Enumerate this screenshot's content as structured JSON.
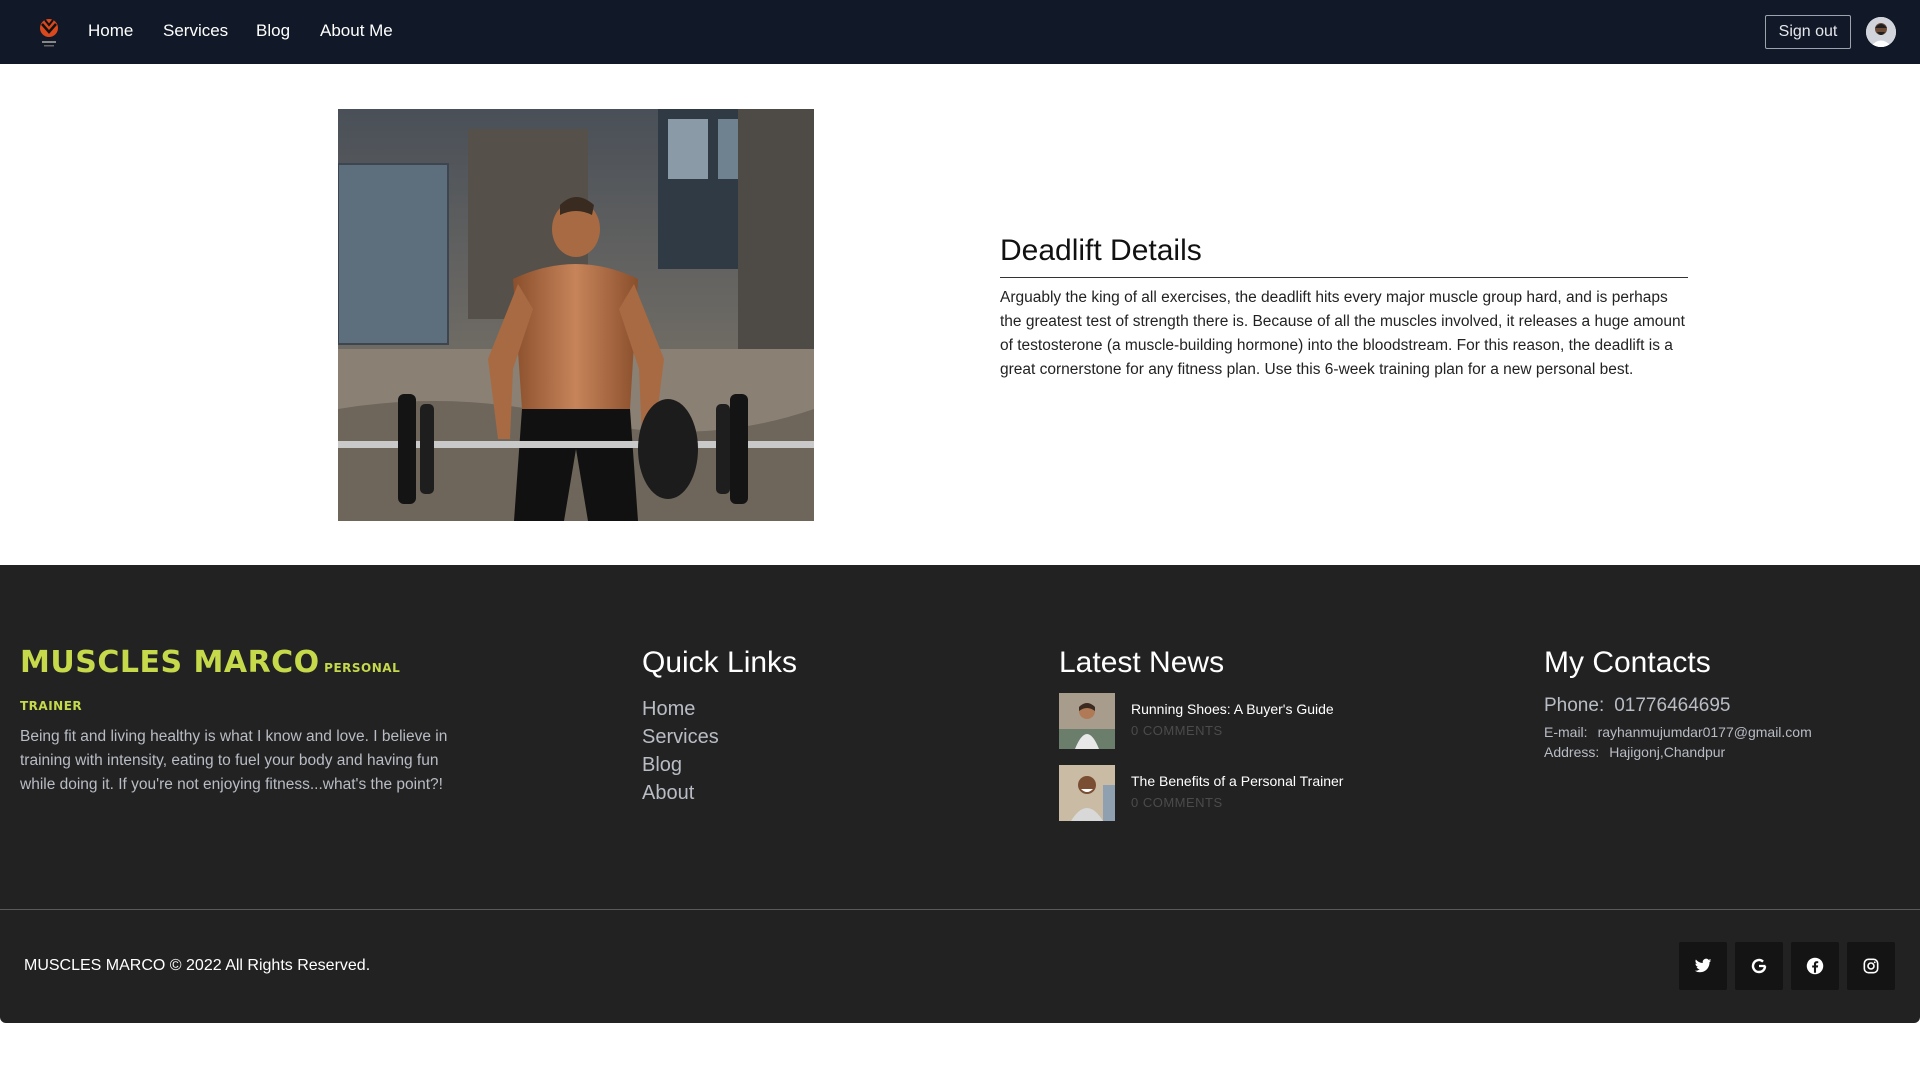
{
  "nav": {
    "links": [
      "Home",
      "Services",
      "Blog",
      "About Me"
    ],
    "sign_out": "Sign out",
    "logo_icon": "muscles-marco-logo",
    "avatar_icon": "user-avatar"
  },
  "article": {
    "image_icon": "deadlift-athlete-photo",
    "title": "Deadlift Details",
    "body": "Arguably the king of all exercises, the deadlift hits every major muscle group hard, and is perhaps the greatest test of strength there is. Because of all the muscles involved, it releases a huge amount of testosterone (a muscle-building hormone) into the bloodstream. For this reason, the deadlift is a great cornerstone for any fitness plan. Use this 6-week training plan for a new personal best."
  },
  "footer": {
    "brand_name": "MUSCLES MARCO",
    "brand_sub_1": "PERSONAL",
    "brand_sub_2": "TRAINER",
    "brand_desc": "Being fit and living healthy is what I know and love. I believe in training with intensity, eating to fuel your body and having fun while doing it. If you're not enjoying fitness...what's the point?!",
    "quick_links_title": "Quick Links",
    "quick_links": [
      "Home",
      "Services",
      "Blog",
      "About"
    ],
    "news_title": "Latest News",
    "news": [
      {
        "title": "Running Shoes: A Buyer's Guide",
        "comments": "0 COMMENTS"
      },
      {
        "title": "The Benefits of a Personal Trainer",
        "comments": "0 COMMENTS"
      }
    ],
    "contacts_title": "My Contacts",
    "phone_label": "Phone:",
    "phone": "01776464695",
    "email_label": "E-mail:",
    "email": "rayhanmujumdar0177@gmail.com",
    "address_label": "Address:",
    "address": "Hajigonj,Chandpur",
    "copyright": "MUSCLES MARCO ©  2022  All Rights Reserved.",
    "social_icons": [
      "twitter-icon",
      "google-icon",
      "facebook-icon",
      "instagram-icon"
    ]
  },
  "colors": {
    "navbar_bg": "#111827",
    "footer_bg": "#222222",
    "brand_accent": "#c5d94a"
  }
}
